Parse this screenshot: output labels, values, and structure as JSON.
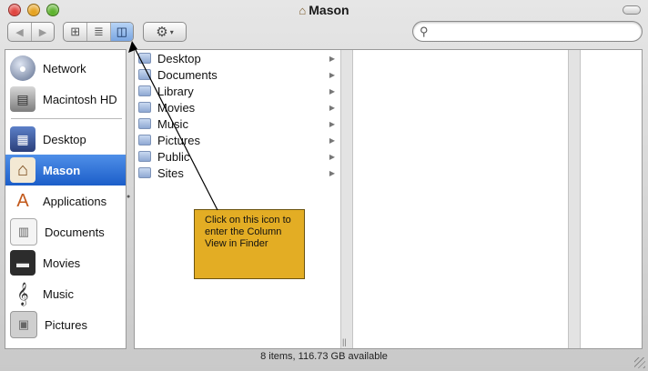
{
  "window": {
    "title": "Mason"
  },
  "toolbar": {
    "back_glyph": "◀",
    "forward_glyph": "▶",
    "view_icon_glyph": "⊞",
    "view_list_glyph": "≣",
    "view_column_glyph": "◫",
    "action_glyph": "⚙",
    "action_caret": "▾",
    "search": {
      "value": "",
      "placeholder": "",
      "icon": "search-icon"
    }
  },
  "sidebar": {
    "devices": [
      {
        "label": "Network",
        "icon": "network-globe-icon",
        "glyph": "●"
      },
      {
        "label": "Macintosh HD",
        "icon": "hard-drive-icon",
        "glyph": "▤"
      }
    ],
    "places": [
      {
        "label": "Desktop",
        "icon": "desktop-icon",
        "glyph": "▦"
      },
      {
        "label": "Mason",
        "icon": "home-icon",
        "glyph": "⌂",
        "selected": true
      },
      {
        "label": "Applications",
        "icon": "applications-icon",
        "glyph": "A"
      },
      {
        "label": "Documents",
        "icon": "documents-icon",
        "glyph": "▥"
      },
      {
        "label": "Movies",
        "icon": "movies-clapper-icon",
        "glyph": "▬"
      },
      {
        "label": "Music",
        "icon": "music-clef-icon",
        "glyph": "𝄞"
      },
      {
        "label": "Pictures",
        "icon": "pictures-icon",
        "glyph": "▣"
      }
    ]
  },
  "column1": {
    "items": [
      {
        "label": "Desktop",
        "icon": "desktop-folder-icon"
      },
      {
        "label": "Documents",
        "icon": "documents-folder-icon"
      },
      {
        "label": "Library",
        "icon": "library-folder-icon"
      },
      {
        "label": "Movies",
        "icon": "movies-folder-icon"
      },
      {
        "label": "Music",
        "icon": "music-folder-icon"
      },
      {
        "label": "Pictures",
        "icon": "pictures-folder-icon"
      },
      {
        "label": "Public",
        "icon": "public-folder-icon"
      },
      {
        "label": "Sites",
        "icon": "sites-folder-icon"
      }
    ]
  },
  "status_bar": {
    "text": "8 items, 116.73 GB available"
  },
  "callout": {
    "text": "Click on this icon to enter the Column View in Finder"
  },
  "colors": {
    "selection": "#1c5ec9",
    "callout_fill": "#e3ad24",
    "close": "#e0443e",
    "minimize": "#e6a21f",
    "zoom": "#5cb22c"
  }
}
